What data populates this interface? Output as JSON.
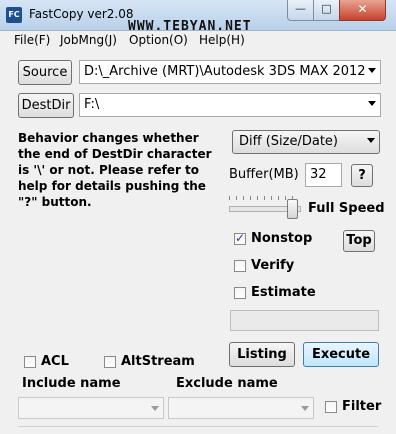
{
  "window": {
    "title": "FastCopy ver2.08",
    "icon_text": "FC",
    "watermark": "WWW.TEBYAN.NET",
    "controls": {
      "minimize": "—",
      "maximize": "□",
      "close": "✕"
    }
  },
  "menu": [
    "File(F)",
    "JobMng(J)",
    "Option(O)",
    "Help(H)"
  ],
  "source": {
    "button": "Source",
    "path": "D:\\_Archive (MRT)\\Autodesk 3DS MAX 2012"
  },
  "destdir": {
    "button": "DestDir",
    "path": "F:\\"
  },
  "info_text": "Behavior changes whether the end of DestDir character is '\\' or not. Please refer to help for details pushing the \"?\" button.",
  "mode": {
    "selected": "Diff (Size/Date)"
  },
  "buffer": {
    "label": "Buffer(MB)",
    "value": "32",
    "help_button": "?"
  },
  "speed": {
    "label": "Full Speed",
    "level_fraction": 1.0
  },
  "options": {
    "nonstop": {
      "label": "Nonstop",
      "checked": true
    },
    "verify": {
      "label": "Verify",
      "checked": false
    },
    "estimate": {
      "label": "Estimate",
      "checked": false
    },
    "top_button": "Top"
  },
  "actions": {
    "listing": "Listing",
    "execute": "Execute"
  },
  "extras": {
    "acl": {
      "label": "ACL",
      "checked": false
    },
    "altstream": {
      "label": "AltStream",
      "checked": false
    }
  },
  "filters": {
    "include_label": "Include name",
    "exclude_label": "Exclude name",
    "filter_label": "Filter",
    "filter_checked": false
  }
}
